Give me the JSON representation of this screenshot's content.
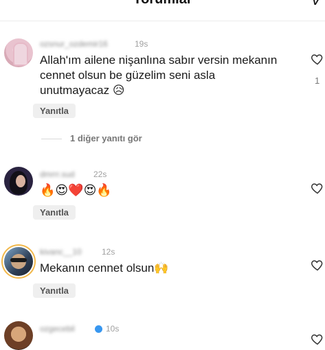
{
  "header": {
    "title": "Yorumlar",
    "action_glyph": "V"
  },
  "comments": [
    {
      "username": "ozsnur_ozdemir16",
      "time": "19s",
      "text": "Allah'ım ailene nişanlına sabır versin mekanın cennet olsun be güzelim seni asla unutmayacaz 😥",
      "reply_label": "Yanıtla",
      "like_count": "1",
      "more_replies": "1 diğer yanıtı gör",
      "avatar_icon": "profile-avatar-icon"
    },
    {
      "username": "dmrrr.sud",
      "time": "22s",
      "text": "🔥😍❤️😍🔥",
      "reply_label": "Yanıtla",
      "avatar_icon": "profile-avatar-icon"
    },
    {
      "username": "kivanc__10",
      "time": "12s",
      "text": "Mekanın cennet olsun🙌",
      "reply_label": "Yanıtla",
      "avatar_icon": "profile-avatar-icon"
    },
    {
      "username": "ozgecebil",
      "time": "10s",
      "verified": true,
      "avatar_icon": "profile-avatar-icon"
    }
  ],
  "icons": {
    "like": "heart-outline-icon",
    "verified": "verified-badge-icon"
  },
  "colors": {
    "background": "#ffffff",
    "text": "#1a1a1a",
    "muted": "#8a8a8a",
    "reply_bg": "#efefef",
    "verified": "#3897f0",
    "story_ring": "#f2b84b"
  }
}
